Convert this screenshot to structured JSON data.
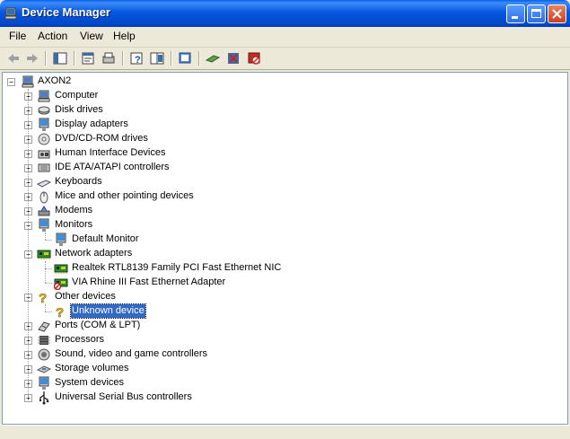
{
  "window": {
    "title": "Device Manager"
  },
  "menu": [
    "File",
    "Action",
    "View",
    "Help"
  ],
  "toolbar": [
    "back-icon",
    "forward-icon",
    "show-hide-tree-icon",
    "properties-icon",
    "print-icon",
    "help-icon",
    "show-hide-console-icon",
    "scan-hardware-icon",
    "update-driver-icon",
    "uninstall-icon",
    "disable-icon"
  ],
  "tree": {
    "root": "AXON2",
    "items": [
      {
        "label": "Computer",
        "icon": "computer-icon",
        "state": "collapsed"
      },
      {
        "label": "Disk drives",
        "icon": "disk-icon",
        "state": "collapsed"
      },
      {
        "label": "Display adapters",
        "icon": "display-icon",
        "state": "collapsed"
      },
      {
        "label": "DVD/CD-ROM drives",
        "icon": "cdrom-icon",
        "state": "collapsed"
      },
      {
        "label": "Human Interface Devices",
        "icon": "hid-icon",
        "state": "collapsed"
      },
      {
        "label": "IDE ATA/ATAPI controllers",
        "icon": "ide-icon",
        "state": "collapsed"
      },
      {
        "label": "Keyboards",
        "icon": "keyboard-icon",
        "state": "collapsed"
      },
      {
        "label": "Mice and other pointing devices",
        "icon": "mouse-icon",
        "state": "collapsed"
      },
      {
        "label": "Modems",
        "icon": "modem-icon",
        "state": "collapsed"
      },
      {
        "label": "Monitors",
        "icon": "monitor-icon",
        "state": "expanded",
        "children": [
          {
            "label": "Default Monitor",
            "icon": "monitor-icon"
          }
        ]
      },
      {
        "label": "Network adapters",
        "icon": "network-card-icon",
        "state": "expanded",
        "children": [
          {
            "label": "Realtek RTL8139 Family PCI Fast Ethernet NIC",
            "icon": "network-card-icon"
          },
          {
            "label": "VIA Rhine III Fast Ethernet Adapter",
            "icon": "network-card-disabled-icon"
          }
        ]
      },
      {
        "label": "Other devices",
        "icon": "unknown-device-icon",
        "state": "expanded",
        "children": [
          {
            "label": "Unknown device",
            "icon": "unknown-device-icon",
            "selected": true
          }
        ]
      },
      {
        "label": "Ports (COM & LPT)",
        "icon": "port-icon",
        "state": "collapsed"
      },
      {
        "label": "Processors",
        "icon": "processor-icon",
        "state": "collapsed"
      },
      {
        "label": "Sound, video and game controllers",
        "icon": "sound-icon",
        "state": "collapsed"
      },
      {
        "label": "Storage volumes",
        "icon": "storage-icon",
        "state": "collapsed"
      },
      {
        "label": "System devices",
        "icon": "system-icon",
        "state": "collapsed"
      },
      {
        "label": "Universal Serial Bus controllers",
        "icon": "usb-icon",
        "state": "collapsed"
      }
    ]
  }
}
